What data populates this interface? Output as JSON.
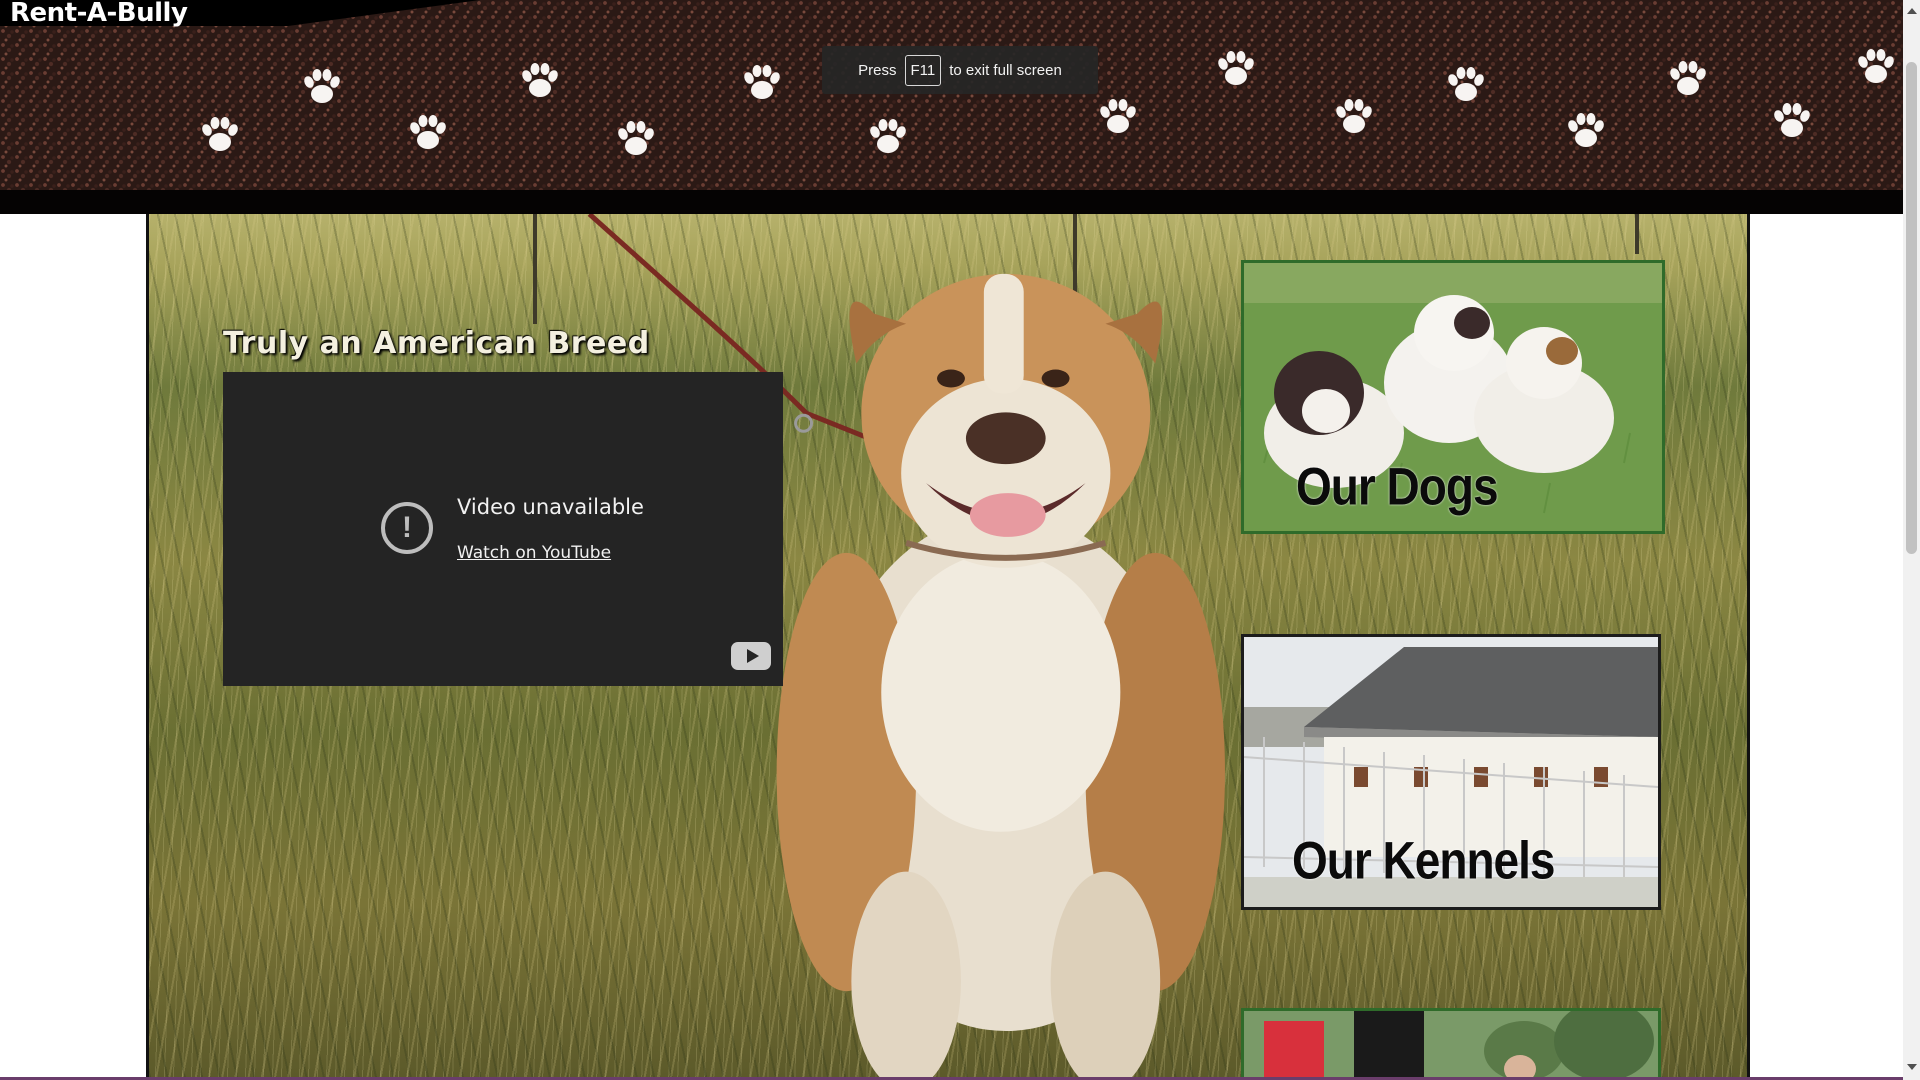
{
  "header": {
    "site_title": "Rent-A-Bully",
    "paw_icon": "paw-print-icon"
  },
  "fullscreen_notice": {
    "prefix": "Press",
    "key": "F11",
    "suffix": "to exit full screen"
  },
  "main": {
    "heading": "Truly an American Breed",
    "video": {
      "message": "Video unavailable",
      "link": "Watch on YouTube",
      "alert_icon": "alert-circle-icon",
      "logo_icon": "youtube-logo-icon"
    },
    "tiles": [
      {
        "label": "Our Dogs"
      },
      {
        "label": "Our Kennels"
      },
      {
        "label": ""
      }
    ]
  },
  "colors": {
    "banner": "#2b1915",
    "video_bg": "#242424"
  }
}
